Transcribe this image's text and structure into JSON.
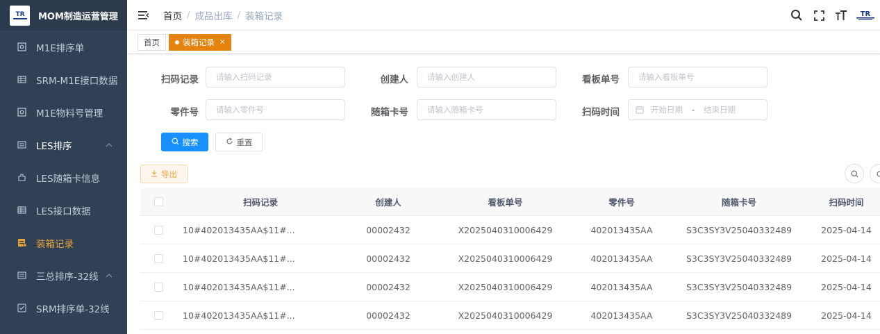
{
  "app": {
    "title": "MOM制造运营管理",
    "logo_text": "TR"
  },
  "sidebar": {
    "items": [
      {
        "label": "M1E排序单",
        "icon": "document-icon"
      },
      {
        "label": "SRM-M1E接口数据",
        "icon": "table-icon"
      },
      {
        "label": "M1E物料号管理",
        "icon": "document-icon"
      },
      {
        "label": "LES排序",
        "icon": "list-icon"
      },
      {
        "label": "LES随箱卡信息",
        "icon": "puzzle-icon"
      },
      {
        "label": "LES接口数据",
        "icon": "table-icon"
      },
      {
        "label": "装箱记录",
        "icon": "package-icon"
      },
      {
        "label": "三总排序-32线",
        "icon": "list-icon"
      },
      {
        "label": "SRM排序单-32线",
        "icon": "checkbox-icon"
      }
    ]
  },
  "header": {
    "breadcrumb": [
      "首页",
      "成品出库",
      "装箱记录"
    ]
  },
  "tags": [
    {
      "label": "首页",
      "active": false
    },
    {
      "label": "装箱记录",
      "active": true
    }
  ],
  "colors": {
    "sidebar_bg": "#304156",
    "primary": "#1890ff",
    "active_tag": "#e6820e",
    "active_menu": "#e6a23c"
  },
  "search": {
    "scan_record_label": "扫码记录",
    "scan_record_placeholder": "请输入扫码记录",
    "creator_label": "创建人",
    "creator_placeholder": "请输入创建人",
    "kanban_label": "看板单号",
    "kanban_placeholder": "请输入看板单号",
    "part_label": "零件号",
    "part_placeholder": "请输入零件号",
    "card_label": "随箱卡号",
    "card_placeholder": "请输入随箱卡号",
    "scan_time_label": "扫码时间",
    "start_date": "开始日期",
    "range_sep": "-",
    "end_date": "结束日期",
    "search_btn": "搜索",
    "reset_btn": "重置",
    "export_btn": "导出"
  },
  "table": {
    "columns": [
      "扫码记录",
      "创建人",
      "看板单号",
      "零件号",
      "随箱卡号",
      "扫码时间"
    ],
    "rows": [
      [
        "10#402013435AA$11#...",
        "00002432",
        "X2025040310006429",
        "402013435AA",
        "S3C3SY3V25040332489",
        "2025-04-14"
      ],
      [
        "10#402013435AA$11#...",
        "00002432",
        "X2025040310006429",
        "402013435AA",
        "S3C3SY3V25040332489",
        "2025-04-14"
      ],
      [
        "10#402013435AA$11#...",
        "00002432",
        "X2025040310006429",
        "402013435AA",
        "S3C3SY3V25040332489",
        "2025-04-14"
      ],
      [
        "10#402013435AA$11#...",
        "00002432",
        "X2025040310006429",
        "402013435AA",
        "S3C3SY3V25040332489",
        "2025-04-14"
      ]
    ]
  }
}
